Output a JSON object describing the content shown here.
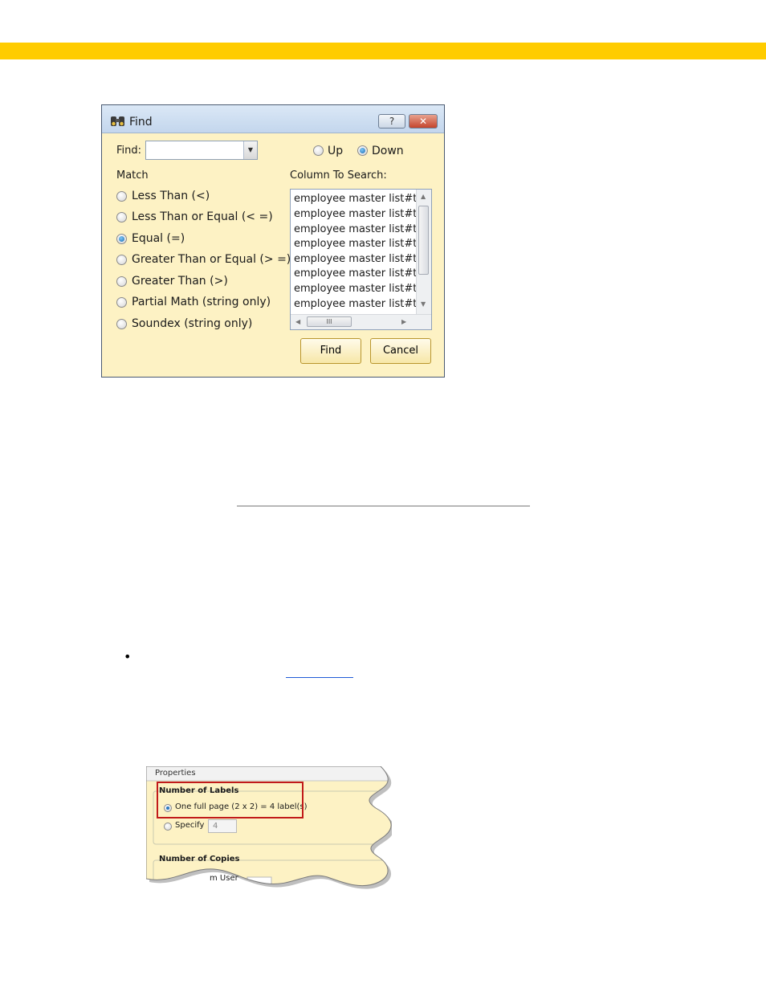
{
  "colors": {
    "topbar": "#ffcc00",
    "dialog_bg": "#fdf2c4",
    "highlight": "#c11a1a",
    "link": "#1f5ad6"
  },
  "find_dialog": {
    "title": "Find",
    "help_label": "?",
    "close_label": "✕",
    "find_label": "Find:",
    "find_value": "",
    "direction": {
      "up": "Up",
      "down": "Down",
      "selected": "Down"
    },
    "match_label": "Match",
    "match_options": [
      "Less Than (<)",
      "Less Than or Equal (< =)",
      "Equal (=)",
      "Greater Than or Equal (> =)",
      "Greater Than (>)",
      "Partial Math (string only)",
      "Soundex (string only)"
    ],
    "match_selected": "Equal (=)",
    "column_label": "Column To Search:",
    "columns": [
      "employee master list#tx",
      "employee master list#tx",
      "employee master list#tx",
      "employee master list#tx",
      "employee master list#tx",
      "employee master list#tx",
      "employee master list#tx",
      "employee master list#tx"
    ],
    "scroll_grip": "III",
    "find_button": "Find",
    "cancel_button": "Cancel"
  },
  "bullet": "•",
  "properties_panel": {
    "title": "Properties",
    "labels_group": "Number of Labels",
    "full_page_option": "One full page (2 x 2) = 4 label(s)",
    "specify_option": "Specify",
    "specify_value": "4",
    "copies_group": "Number of Copies",
    "from_user_fragment": "m User"
  }
}
